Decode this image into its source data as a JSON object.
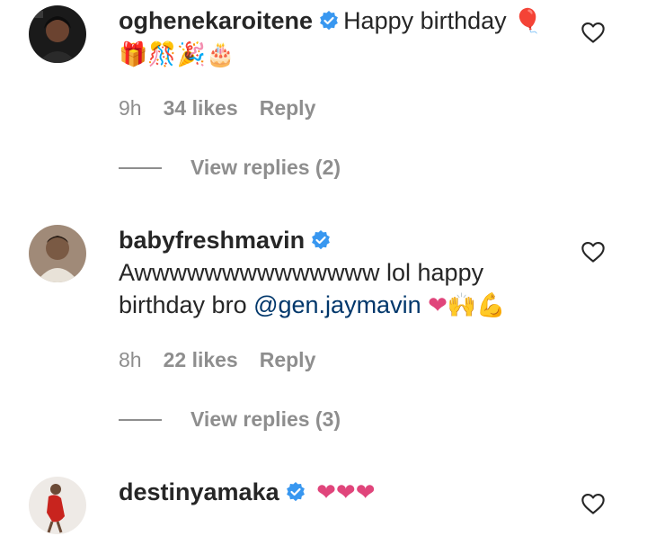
{
  "comments": [
    {
      "username": "oghenekaroitene",
      "text": "Happy birthday",
      "emoji_inline": "🎈",
      "emoji_line2": "🎁🎊🎉🎂",
      "time": "9h",
      "likes": "34 likes",
      "reply": "Reply",
      "view_replies": "View replies (2)"
    },
    {
      "username": "babyfreshmavin",
      "text_line1": "Awwwwwwwwwwwwww lol happy",
      "text_line2_pre": "birthday bro ",
      "mention": "@gen.jaymavin",
      "emojis": "❤🙌💪",
      "time": "8h",
      "likes": "22 likes",
      "reply": "Reply",
      "view_replies": "View replies (3)"
    },
    {
      "username": "destinyamaka",
      "emojis": "❤❤❤"
    }
  ],
  "colors": {
    "verified": "#3897f0",
    "heart_emoji": "#e0457b",
    "mention": "#00376b",
    "meta": "#8e8e8e"
  },
  "icons": {
    "verified": "verified-badge-icon",
    "like": "heart-outline-icon"
  }
}
